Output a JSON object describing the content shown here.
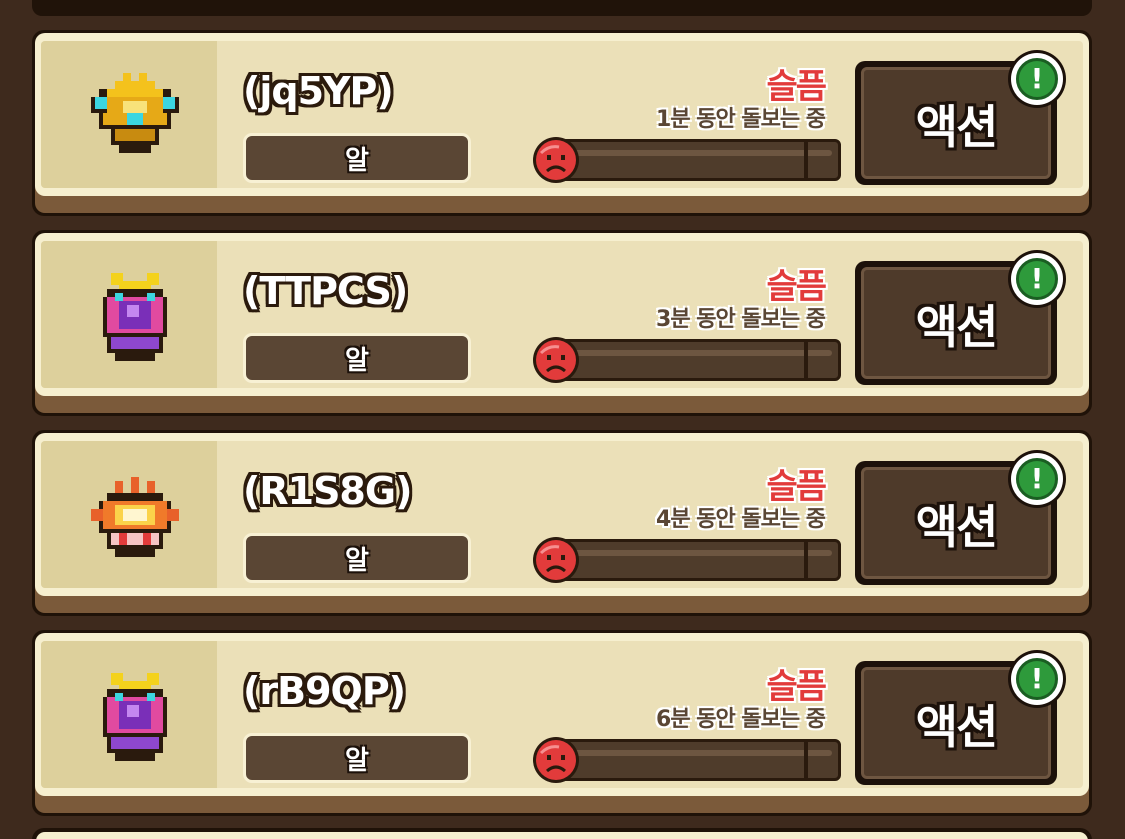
{
  "colors": {
    "background": "#3e2a1d",
    "card_face": "#f6efcf",
    "mood_red": "#e23b3b",
    "alert_green": "#2e9a3b",
    "button_brown": "#4e3a2a"
  },
  "pets": [
    {
      "name": "(jq5YP)",
      "type": "알",
      "mood": "슬픔",
      "care_status": "1분 동안 돌보는 중",
      "mood_level": 0.05,
      "action_label": "액션",
      "alert": "!",
      "icon": "gold-crown-egg-icon"
    },
    {
      "name": "(TTPCS)",
      "type": "알",
      "mood": "슬픔",
      "care_status": "3분 동안 돌보는 중",
      "mood_level": 0.05,
      "action_label": "액션",
      "alert": "!",
      "icon": "purple-jewel-egg-icon"
    },
    {
      "name": "(R1S8G)",
      "type": "알",
      "mood": "슬픔",
      "care_status": "4분 동안 돌보는 중",
      "mood_level": 0.05,
      "action_label": "액션",
      "alert": "!",
      "icon": "flame-egg-icon"
    },
    {
      "name": "(rB9QP)",
      "type": "알",
      "mood": "슬픔",
      "care_status": "6분 동안 돌보는 중",
      "mood_level": 0.05,
      "action_label": "액션",
      "alert": "!",
      "icon": "purple-jewel-egg-icon"
    }
  ]
}
